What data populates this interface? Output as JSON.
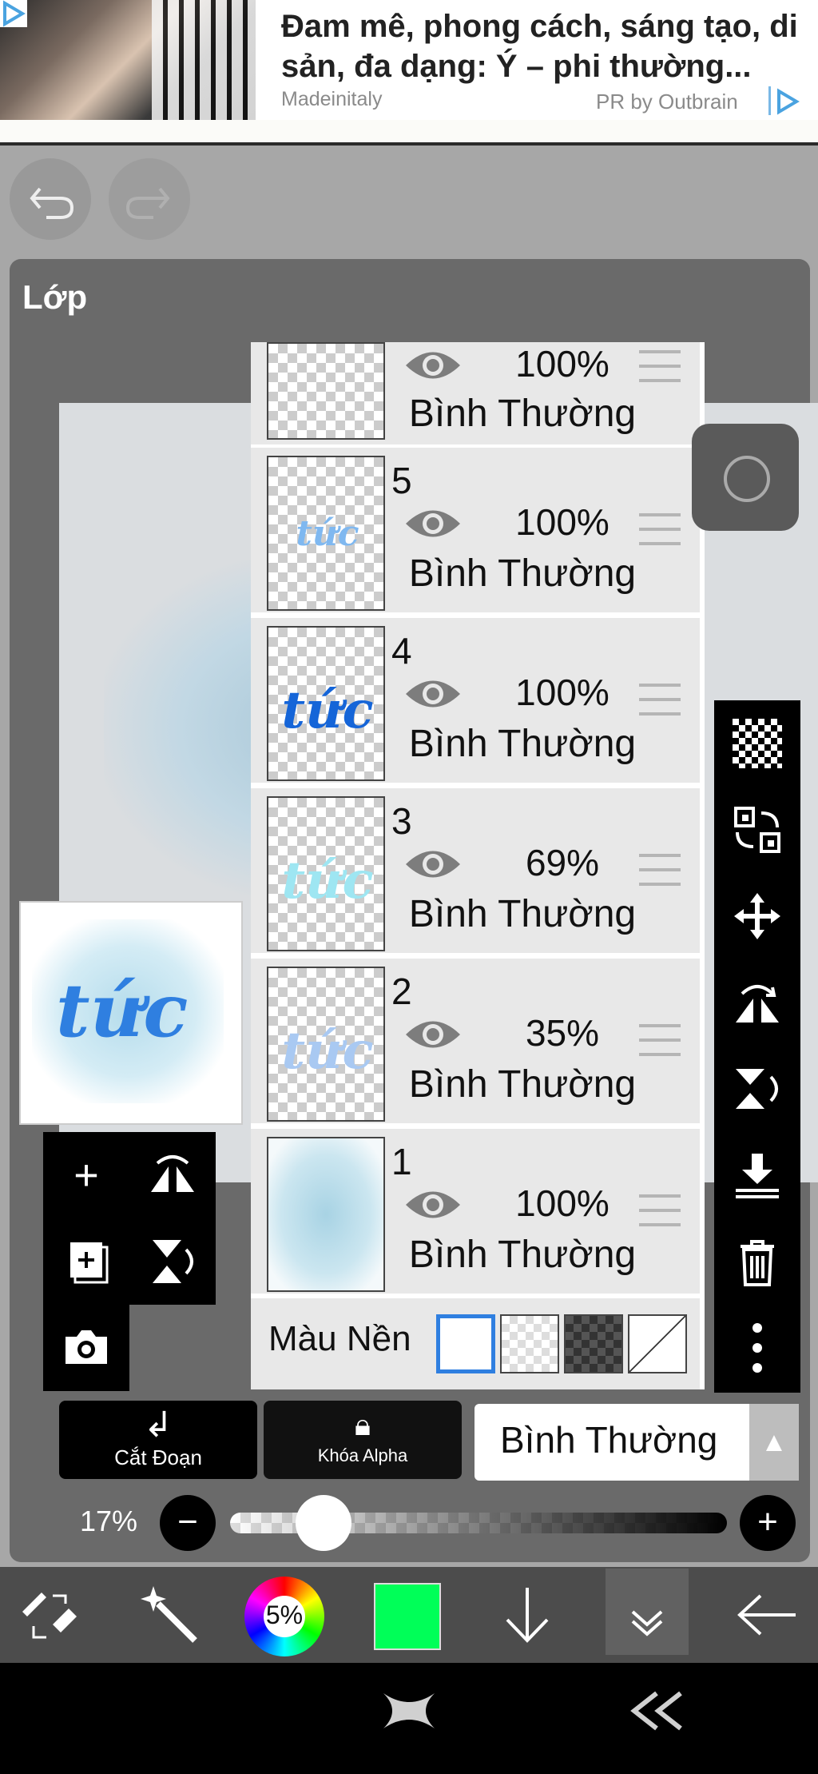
{
  "ad": {
    "title": "Đam mê, phong cách, sáng tạo, di sản, đa dạng: Ý – phi thường...",
    "source": "Madeinitaly",
    "pr": "PR by Outbrain"
  },
  "panel": {
    "title": "Lớp"
  },
  "layers": [
    {
      "num": "",
      "opacity": "100%",
      "mode": "Bình Thường",
      "thumb_text": ""
    },
    {
      "num": "5",
      "opacity": "100%",
      "mode": "Bình Thường",
      "thumb_text": "tức"
    },
    {
      "num": "4",
      "opacity": "100%",
      "mode": "Bình Thường",
      "thumb_text": "tức"
    },
    {
      "num": "3",
      "opacity": "69%",
      "mode": "Bình Thường",
      "thumb_text": "tức"
    },
    {
      "num": "2",
      "opacity": "35%",
      "mode": "Bình Thường",
      "thumb_text": "tức"
    },
    {
      "num": "1",
      "opacity": "100%",
      "mode": "Bình Thường",
      "thumb_text": ""
    }
  ],
  "background": {
    "label": "Màu Nền"
  },
  "canvas": {
    "thumb_text": "tức"
  },
  "buttons": {
    "clip": "Cắt Đoạn",
    "alpha_lock": "Khóa Alpha",
    "blend_mode": "Bình Thường"
  },
  "opacity_slider": {
    "label": "17%",
    "value": 0.17
  },
  "color_wheel": {
    "label": "5%"
  },
  "colors": {
    "current": "#00ff58",
    "panel": "#6a6a6a",
    "accent": "#2f7fe0"
  },
  "icons": [
    "undo-icon",
    "redo-icon",
    "plus-icon",
    "add-layer-icon",
    "camera-icon",
    "flip-icon",
    "rotate-icon",
    "checker-icon",
    "transform-icon",
    "move-icon",
    "flip-h-icon",
    "flip-v-icon",
    "merge-down-icon",
    "trash-icon",
    "more-icon",
    "eye-icon",
    "handle-icon",
    "record-icon"
  ]
}
